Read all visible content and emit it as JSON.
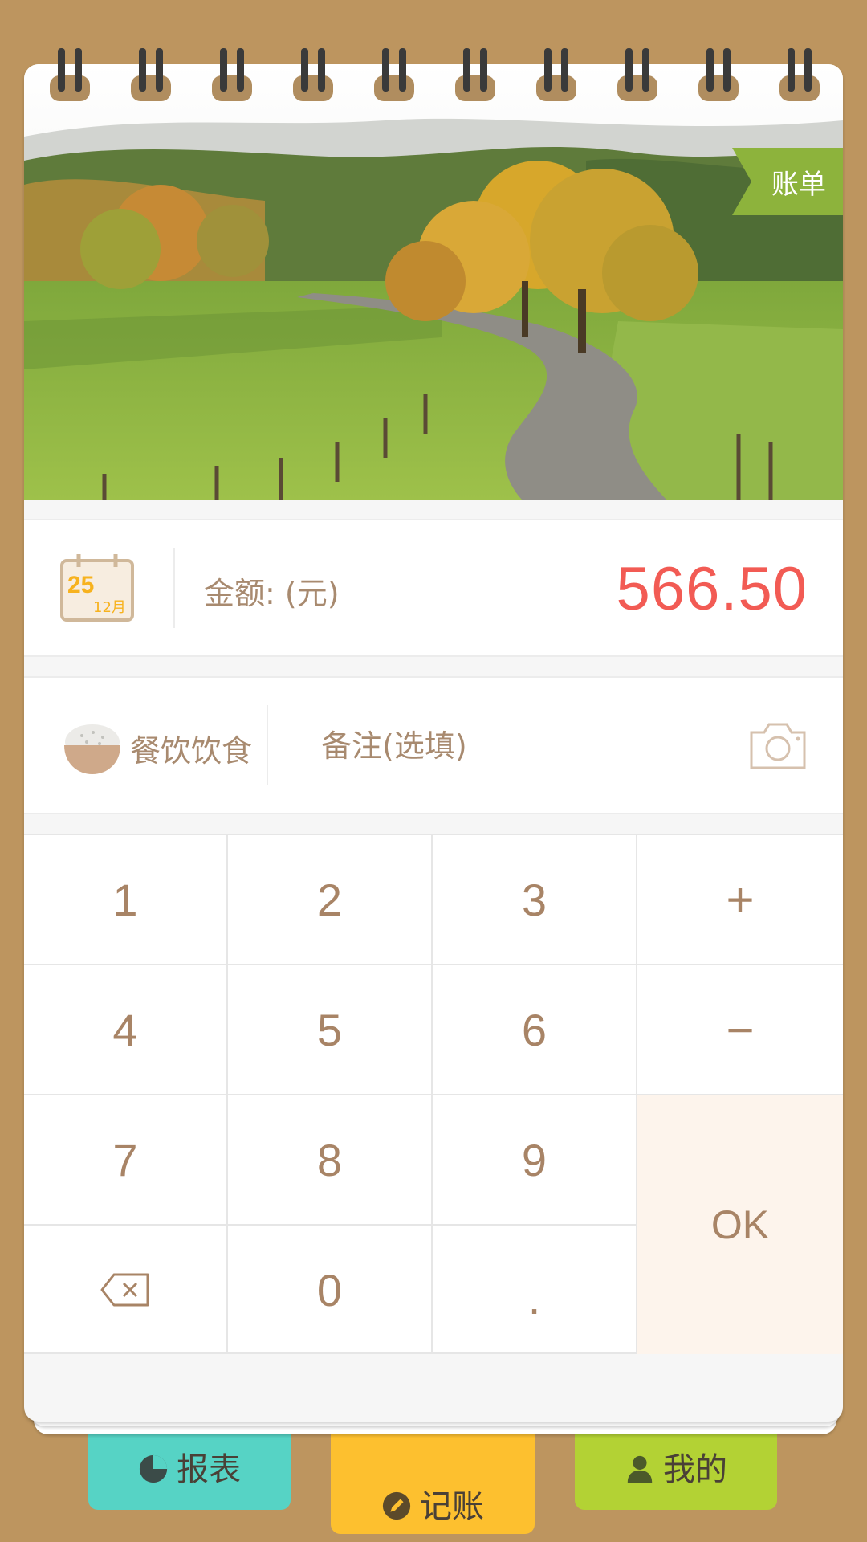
{
  "header": {
    "bill_tag": "账单"
  },
  "date": {
    "day": "25",
    "month": "12月"
  },
  "amount": {
    "label": "金额: (元)",
    "value": "566.50"
  },
  "category": {
    "label": "餐饮饮食",
    "icon": "rice-bowl-icon"
  },
  "memo": {
    "placeholder": "备注(选填)",
    "value": ""
  },
  "keypad": {
    "keys": [
      "1",
      "2",
      "3",
      "+",
      "4",
      "5",
      "6",
      "−",
      "7",
      "8",
      "9",
      "0",
      "."
    ],
    "ok_label": "OK",
    "backspace_icon": "backspace-icon"
  },
  "tabs": [
    {
      "label": "报表",
      "icon": "pie-chart-icon",
      "color": "#56d3c5"
    },
    {
      "label": "记账",
      "icon": "pencil-icon",
      "color": "#fdc02f"
    },
    {
      "label": "我的",
      "icon": "user-icon",
      "color": "#b3d234"
    }
  ],
  "colors": {
    "background": "#bd955f",
    "amount": "#f25b54",
    "text": "#a88466",
    "bill_tag": "#8db33c",
    "ok_key": "#fdf4ec"
  }
}
